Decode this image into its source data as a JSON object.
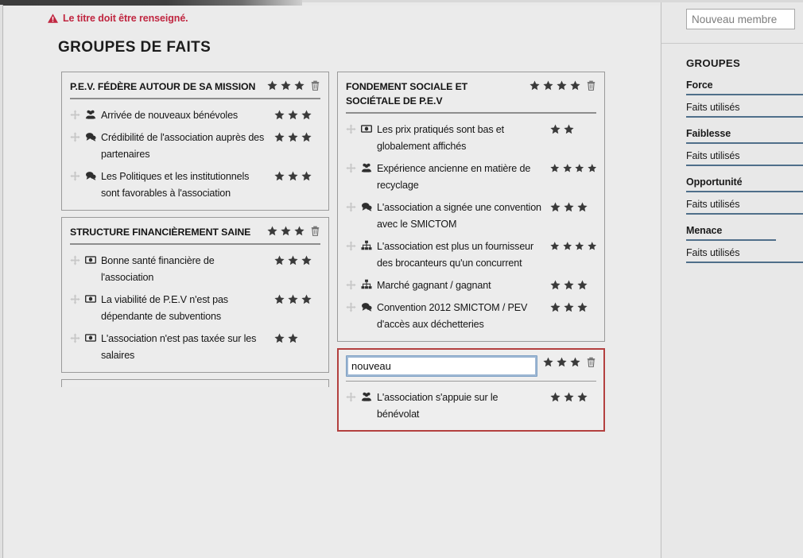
{
  "error": {
    "icon": "warning-triangle-icon",
    "message": "Le titre doit être renseigné."
  },
  "page": {
    "title": "GROUPES DE FAITS"
  },
  "groups": [
    {
      "id": "group-pev-federe",
      "title": "P.E.V. FÉDÈRE AUTOUR DE SA MISSION",
      "stars": 3,
      "editing": false,
      "error": false,
      "column": "left",
      "facts": [
        {
          "icon": "people-group-icon",
          "text": "Arrivée de nouveaux bénévoles",
          "stars": 3
        },
        {
          "icon": "speech-bubble-icon",
          "text": "Crédibilité de l'association auprès des partenaires",
          "stars": 3
        },
        {
          "icon": "speech-bubble-icon",
          "text": "Les Politiques et les institutionnels sont favorables à l'association",
          "stars": 3
        }
      ]
    },
    {
      "id": "group-structure-financiere",
      "title": "STRUCTURE FINANCIÈREMENT SAINE",
      "stars": 3,
      "editing": false,
      "error": false,
      "column": "left",
      "facts": [
        {
          "icon": "banknote-icon",
          "text": "Bonne santé financière de l'association",
          "stars": 3
        },
        {
          "icon": "banknote-icon",
          "text": "La viabilité de P.E.V n'est pas dépendante de subventions",
          "stars": 3
        },
        {
          "icon": "banknote-icon",
          "text": "L'association n'est pas taxée sur les salaires",
          "stars": 2
        }
      ]
    },
    {
      "id": "group-fondement-sociale",
      "title": "FONDEMENT SOCIALE ET SOCIÉTALE DE P.E.V",
      "stars": 4,
      "editing": false,
      "error": false,
      "column": "right",
      "facts": [
        {
          "icon": "banknote-icon",
          "text": "Les prix pratiqués sont bas et globalement affichés",
          "stars": 2
        },
        {
          "icon": "people-group-icon",
          "text": "Expérience ancienne en matière de recyclage",
          "stars": 4
        },
        {
          "icon": "speech-bubble-icon",
          "text": "L'association a signée une convention avec le SMICTOM",
          "stars": 3
        },
        {
          "icon": "sitemap-icon",
          "text": "L'association est plus un fournisseur des brocanteurs qu'un concurrent",
          "stars": 4
        },
        {
          "icon": "sitemap-icon",
          "text": "Marché gagnant / gagnant",
          "stars": 3
        },
        {
          "icon": "speech-bubble-icon",
          "text": "Convention 2012 SMICTOM / PEV d'accès aux déchetteries",
          "stars": 3
        }
      ]
    },
    {
      "id": "group-nouveau",
      "title": "",
      "title_value": "nouveau",
      "title_placeholder": "",
      "stars": 3,
      "editing": true,
      "error": true,
      "column": "right",
      "facts": [
        {
          "icon": "people-group-icon",
          "text": "L'association s'appuie sur le bénévolat",
          "stars": 3
        }
      ]
    }
  ],
  "sidebar": {
    "member_input": {
      "value": "",
      "placeholder": "Nouveau membre"
    },
    "groupes_title": "GROUPES",
    "swot": [
      {
        "name": "Force",
        "used_label": "Faits utilisés"
      },
      {
        "name": "Faiblesse",
        "used_label": "Faits utilisés"
      },
      {
        "name": "Opportunité",
        "used_label": "Faits utilisés"
      },
      {
        "name": "Menace",
        "used_label": "Faits utilisés"
      }
    ]
  },
  "colors": {
    "error_red": "#c02640",
    "card_error_border": "#b3403f",
    "star": "#3a3a3a",
    "swot_underline": "#4f6f8a",
    "page_bg": "#ebebeb",
    "focus_ring": "#7da0c4"
  }
}
